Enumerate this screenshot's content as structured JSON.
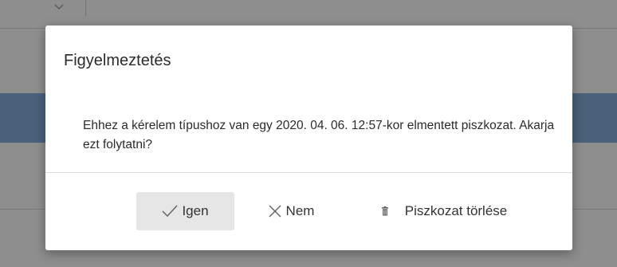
{
  "dialog": {
    "title": "Figyelmeztetés",
    "message": "Ehhez a kérelem típushoz van egy 2020. 04. 06. 12:57-kor elmentett piszkozat. Akarja ezt folytatni?",
    "buttons": {
      "yes_label": "Igen",
      "no_label": "Nem",
      "delete_label": "Piszkozat törlése"
    },
    "icons": {
      "yes": "check-icon",
      "no": "close-icon",
      "delete": "trash-icon"
    }
  },
  "colors": {
    "selected_row": "#7ea9d2",
    "yes_button_bg": "#e6e6e6"
  }
}
